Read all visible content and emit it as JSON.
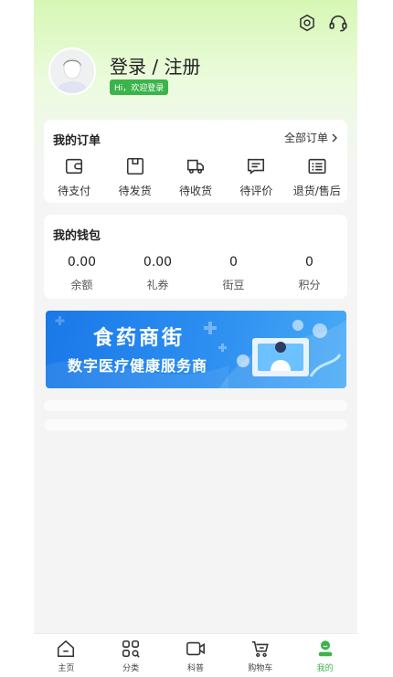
{
  "header": {
    "login_title": "登录 / 注册",
    "login_badge": "Hi，欢迎登录"
  },
  "orders": {
    "title": "我的订单",
    "all_label": "全部订单",
    "items": [
      {
        "label": "待支付",
        "icon": "wallet-icon"
      },
      {
        "label": "待发货",
        "icon": "box-icon"
      },
      {
        "label": "待收货",
        "icon": "truck-icon"
      },
      {
        "label": "待评价",
        "icon": "comment-icon"
      },
      {
        "label": "退货/售后",
        "icon": "list-icon"
      }
    ]
  },
  "wallet": {
    "title": "我的钱包",
    "items": [
      {
        "value": "0.00",
        "label": "余额"
      },
      {
        "value": "0.00",
        "label": "礼券"
      },
      {
        "value": "0",
        "label": "街豆"
      },
      {
        "value": "0",
        "label": "积分"
      }
    ]
  },
  "banner": {
    "title": "食药商街",
    "subtitle": "数字医疗健康服务商"
  },
  "tabbar": {
    "items": [
      {
        "label": "主页",
        "icon": "home-icon"
      },
      {
        "label": "分类",
        "icon": "category-icon"
      },
      {
        "label": "科普",
        "icon": "video-icon"
      },
      {
        "label": "购物车",
        "icon": "cart-icon"
      },
      {
        "label": "我的",
        "icon": "profile-icon"
      }
    ],
    "active": "我的"
  },
  "colors": {
    "accent": "#3bb44a",
    "banner": "#1a78e8"
  }
}
